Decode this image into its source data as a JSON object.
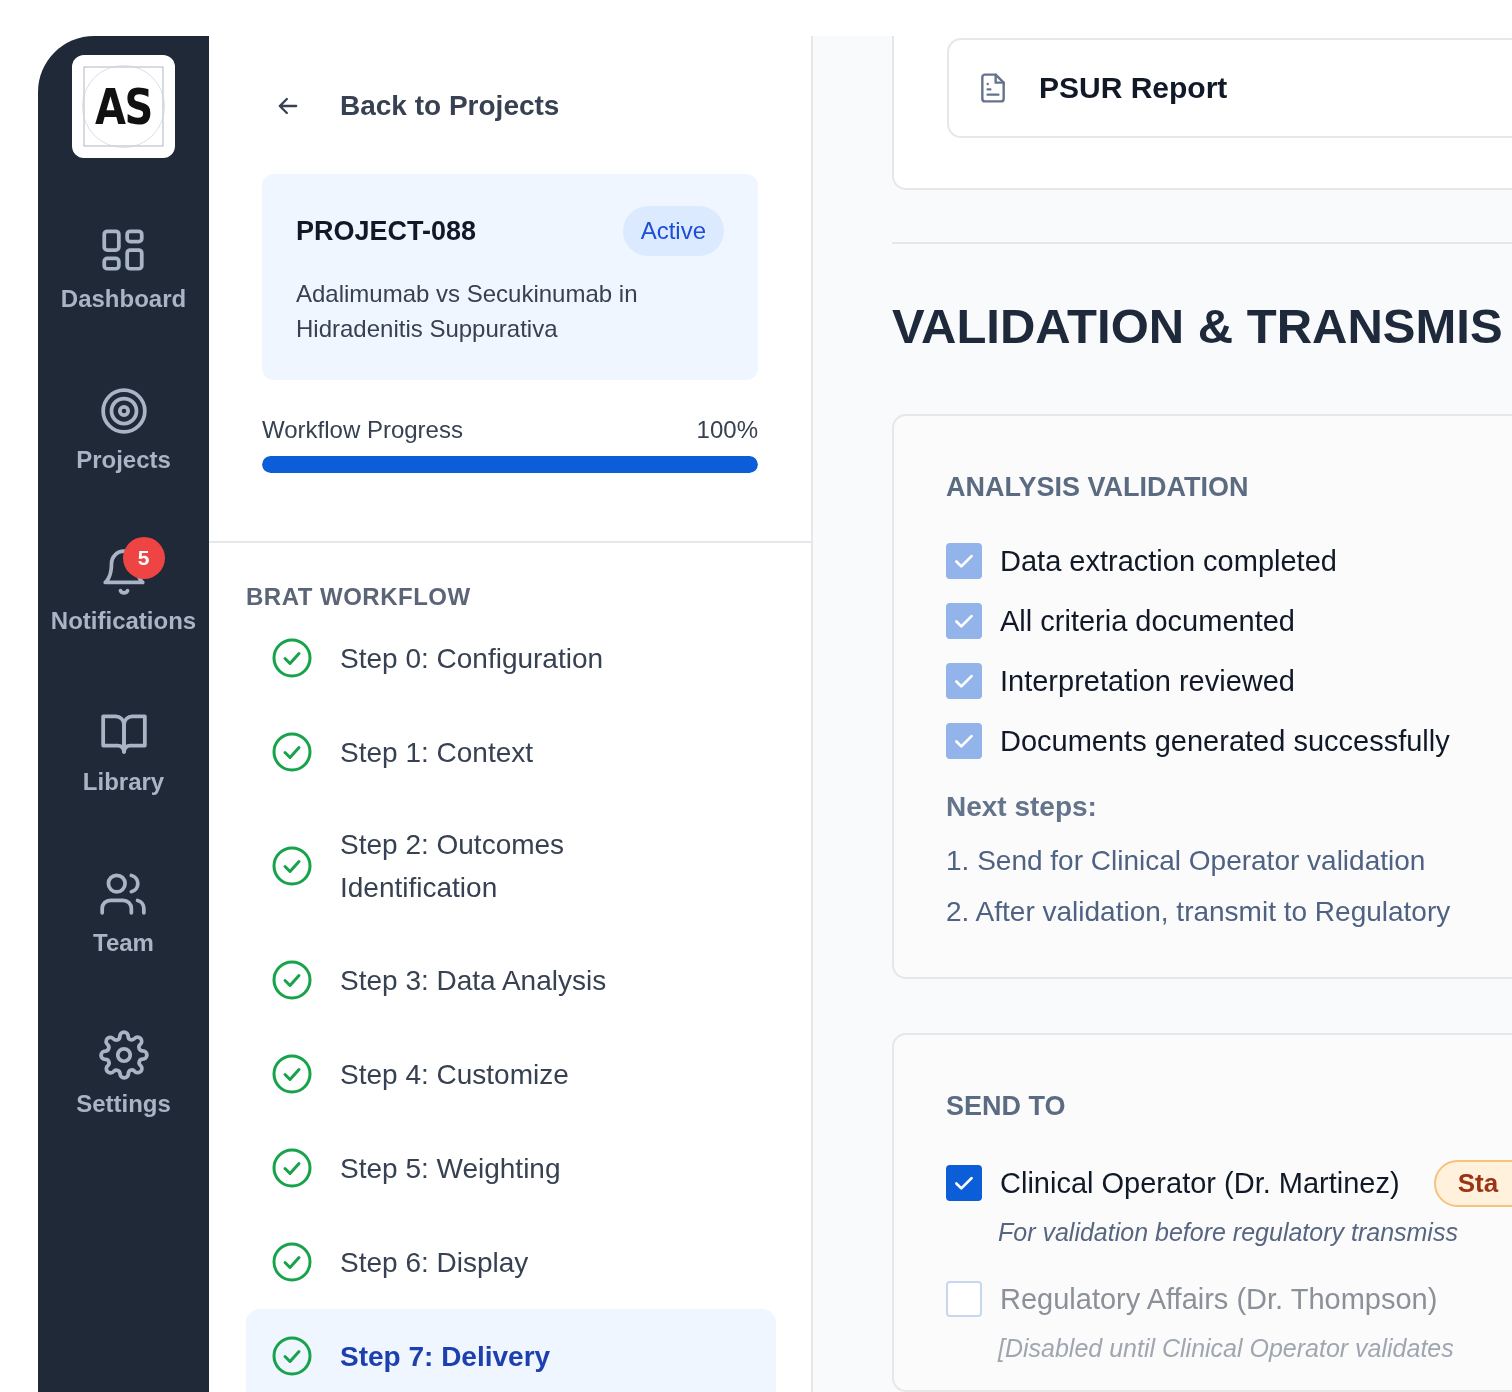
{
  "sidebar": {
    "logo": "AS",
    "items": [
      {
        "label": "Dashboard"
      },
      {
        "label": "Projects"
      },
      {
        "label": "Notifications",
        "badge": "5"
      },
      {
        "label": "Library"
      },
      {
        "label": "Team"
      },
      {
        "label": "Settings"
      }
    ]
  },
  "panel": {
    "back": "Back to Projects",
    "project": {
      "id": "PROJECT-088",
      "status": "Active",
      "title": "Adalimumab vs Secukinumab in Hidradenitis Suppurativa"
    },
    "progress": {
      "label": "Workflow Progress",
      "value": "100%",
      "level": 1
    },
    "workflow": {
      "title": "BRAT WORKFLOW",
      "steps": [
        {
          "label": "Step 0: Configuration",
          "done": true,
          "selected": false
        },
        {
          "label": "Step 1: Context",
          "done": true,
          "selected": false
        },
        {
          "label": "Step 2: Outcomes Identification",
          "done": true,
          "selected": false
        },
        {
          "label": "Step 3: Data Analysis",
          "done": true,
          "selected": false
        },
        {
          "label": "Step 4: Customize",
          "done": true,
          "selected": false
        },
        {
          "label": "Step 5: Weighting",
          "done": true,
          "selected": false
        },
        {
          "label": "Step 6: Display",
          "done": true,
          "selected": false
        },
        {
          "label": "Step 7: Delivery",
          "done": true,
          "selected": true
        }
      ]
    }
  },
  "main": {
    "report": {
      "label": "PSUR Report"
    },
    "heading": "VALIDATION & TRANSMIS",
    "validation": {
      "title": "ANALYSIS VALIDATION",
      "items": [
        {
          "label": "Data extraction completed",
          "checked": true,
          "disabled": true
        },
        {
          "label": "All criteria documented",
          "checked": true,
          "disabled": true
        },
        {
          "label": "Interpretation reviewed",
          "checked": true,
          "disabled": true
        },
        {
          "label": "Documents generated successfully",
          "checked": true,
          "disabled": true
        }
      ],
      "next_title": "Next steps:",
      "next_steps": [
        "1. Send for Clinical Operator validation",
        "2. After validation, transmit to Regulatory"
      ]
    },
    "send_to": {
      "title": "SEND TO",
      "recipients": [
        {
          "name": "Clinical Operator (Dr. Martinez)",
          "checked": true,
          "disabled": false,
          "badge": "Sta",
          "note": "For validation before regulatory transmiss"
        },
        {
          "name": "Regulatory Affairs (Dr. Thompson)",
          "checked": false,
          "disabled": true,
          "note": "[Disabled until Clinical Operator validates"
        }
      ]
    }
  }
}
